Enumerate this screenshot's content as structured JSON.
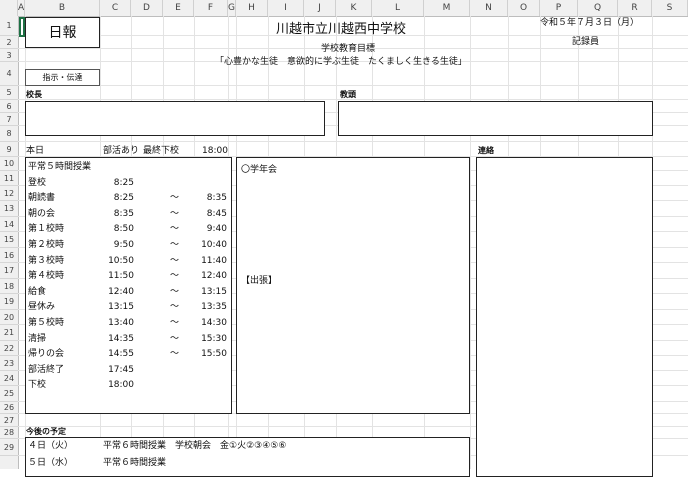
{
  "columns": [
    "A",
    "B",
    "C",
    "D",
    "E",
    "F",
    "G",
    "H",
    "I",
    "J",
    "K",
    "L",
    "M",
    "N",
    "O",
    "P",
    "Q",
    "R",
    "S"
  ],
  "rows": [
    "1",
    "2",
    "3",
    "4",
    "5",
    "6",
    "7",
    "8",
    "9",
    "10",
    "11",
    "12",
    "13",
    "14",
    "15",
    "16",
    "17",
    "18",
    "19",
    "20",
    "21",
    "22",
    "23",
    "24",
    "25",
    "26",
    "27",
    "28",
    "29"
  ],
  "header": {
    "nippo": "日報",
    "school": "川越市立川越西中学校",
    "date": "令和５年７月３日（月）",
    "kirokuin": "記録員",
    "goal_title": "学校教育目標",
    "goal": "「心豊かな生徒　意欲的に学ぶ生徒　たくましく生きる生徒」",
    "shiji_button": "指示・伝達"
  },
  "labels": {
    "kocho": "校長",
    "kyoto": "教頭",
    "renraku": "連絡",
    "gakunenkai": "〇学年会",
    "shutcho": "【出張】",
    "kongo": "今後の予定"
  },
  "schedule_header": {
    "day": "本日",
    "bukatsu": "部活あり",
    "saishu": "最終下校",
    "saishu_time": "18:00"
  },
  "schedule": [
    {
      "name": "平常５時間授業",
      "start": "",
      "tilde": "",
      "end": ""
    },
    {
      "name": "登校",
      "start": "8:25",
      "tilde": "",
      "end": ""
    },
    {
      "name": "朝読書",
      "start": "8:25",
      "tilde": "～",
      "end": "8:35"
    },
    {
      "name": "朝の会",
      "start": "8:35",
      "tilde": "～",
      "end": "8:45"
    },
    {
      "name": "第１校時",
      "start": "8:50",
      "tilde": "～",
      "end": "9:40"
    },
    {
      "name": "第２校時",
      "start": "9:50",
      "tilde": "～",
      "end": "10:40"
    },
    {
      "name": "第３校時",
      "start": "10:50",
      "tilde": "～",
      "end": "11:40"
    },
    {
      "name": "第４校時",
      "start": "11:50",
      "tilde": "～",
      "end": "12:40"
    },
    {
      "name": "給食",
      "start": "12:40",
      "tilde": "～",
      "end": "13:15"
    },
    {
      "name": "昼休み",
      "start": "13:15",
      "tilde": "～",
      "end": "13:35"
    },
    {
      "name": "第５校時",
      "start": "13:40",
      "tilde": "～",
      "end": "14:30"
    },
    {
      "name": "清掃",
      "start": "14:35",
      "tilde": "～",
      "end": "15:30"
    },
    {
      "name": "帰りの会",
      "start": "14:55",
      "tilde": "～",
      "end": "15:50"
    },
    {
      "name": "部活終了",
      "start": "17:45",
      "tilde": "",
      "end": ""
    },
    {
      "name": "下校",
      "start": "18:00",
      "tilde": "",
      "end": ""
    }
  ],
  "future": [
    {
      "day": "４日（火）",
      "text": "平常６時間授業　学校朝会　金①火②③④⑤⑥"
    },
    {
      "day": "５日（水）",
      "text": "平常６時間授業"
    }
  ]
}
